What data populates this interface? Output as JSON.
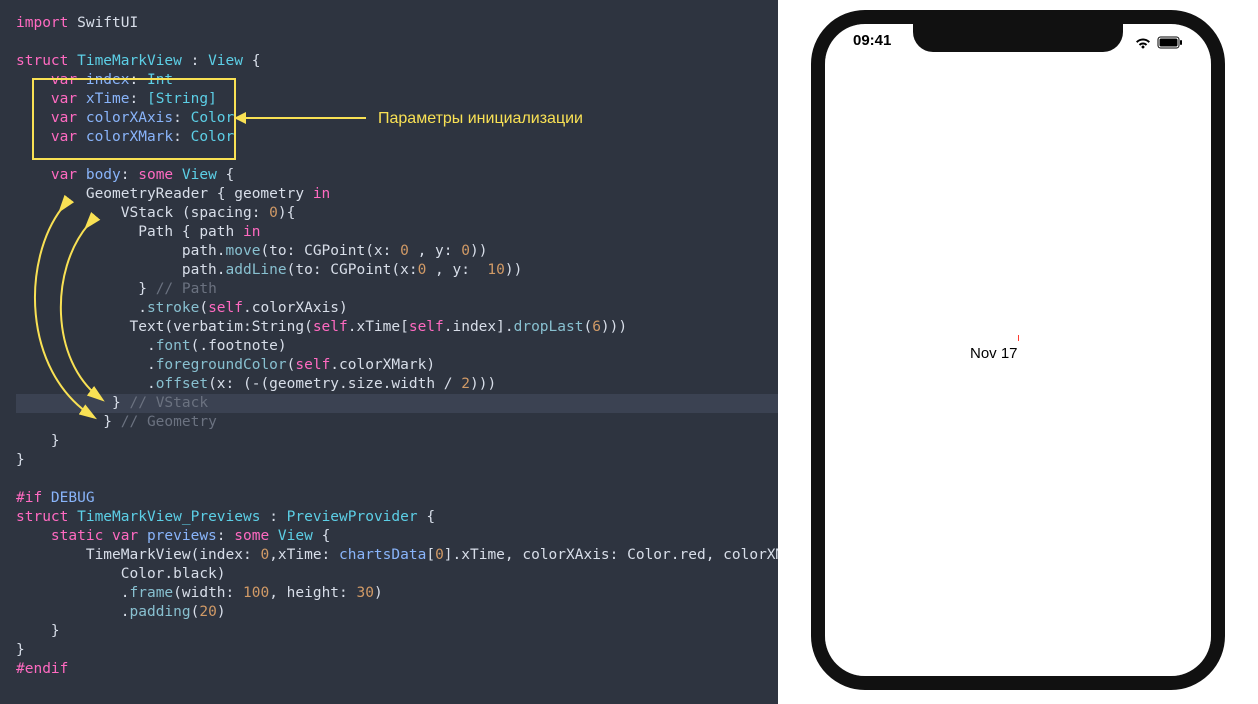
{
  "annotation": {
    "label": "Параметры инициализации"
  },
  "phone": {
    "time": "09:41",
    "content_label": "Nov 17"
  },
  "code": {
    "l1_import": "import",
    "l1_mod": " SwiftUI",
    "l3_struct": "struct",
    "l3_name": " TimeMarkView ",
    "l3_colon": ": ",
    "l3_view": "View",
    "l3_brace": " {",
    "l4_var": "    var",
    "l4_name": " index",
    "l4_colon": ": ",
    "l4_type": "Int",
    "l5_var": "    var",
    "l5_name": " xTime",
    "l5_colon": ": ",
    "l5_type": "[String]",
    "l6_var": "    var",
    "l6_name": " colorXAxis",
    "l6_colon": ": ",
    "l6_type": "Color",
    "l7_var": "    var",
    "l7_name": " colorXMark",
    "l7_colon": ": ",
    "l7_type": "Color",
    "l9_var": "    var",
    "l9_name": " body",
    "l9_colon": ": ",
    "l9_some": "some",
    "l9_view": " View",
    "l9_brace": " {",
    "l10": "        GeometryReader { geometry ",
    "l10_in": "in",
    "l11a": "            VStack (spacing: ",
    "l11b": "0",
    "l11c": "){",
    "l12a": "              Path { path ",
    "l12_in": "in",
    "l13a": "                   path.",
    "l13b": "move",
    "l13c": "(to: CGPoint(x: ",
    "l13d": "0",
    "l13e": " , y: ",
    "l13f": "0",
    "l13g": "))",
    "l14a": "                   path.",
    "l14b": "addLine",
    "l14c": "(to: CGPoint(x:",
    "l14d": "0",
    "l14e": " , y:  ",
    "l14f": "10",
    "l14g": "))",
    "l15a": "              } ",
    "l15b": "// Path",
    "l16a": "              .",
    "l16b": "stroke",
    "l16c": "(",
    "l16d": "self",
    "l16e": ".colorXAxis)",
    "l17a": "             Text(verbatim:String(",
    "l17b": "self",
    "l17c": ".xTime[",
    "l17d": "self",
    "l17e": ".index].",
    "l17f": "dropLast",
    "l17g": "(",
    "l17h": "6",
    "l17i": ")))",
    "l18a": "               .",
    "l18b": "font",
    "l18c": "(.footnote)",
    "l19a": "               .",
    "l19b": "foregroundColor",
    "l19c": "(",
    "l19d": "self",
    "l19e": ".colorXMark)",
    "l20a": "               .",
    "l20b": "offset",
    "l20c": "(x: (-(geometry.size.width / ",
    "l20d": "2",
    "l20e": ")))",
    "l21a": "           } ",
    "l21b": "// VStack",
    "l22a": "          } ",
    "l22b": "// Geometry",
    "l23": "    }",
    "l24": "}",
    "l26_if": "#if",
    "l26_dbg": " DEBUG",
    "l27_struct": "struct",
    "l27_name": " TimeMarkView_Previews ",
    "l27_colon": ": ",
    "l27_pp": "PreviewProvider",
    "l27_brace": " {",
    "l28a": "    static var",
    "l28b": " previews",
    "l28c": ": ",
    "l28d": "some",
    "l28e": " View",
    "l28f": " {",
    "l29a": "        TimeMarkView(index: ",
    "l29b": "0",
    "l29c": ",xTime: ",
    "l29d": "chartsData",
    "l29e": "[",
    "l29f": "0",
    "l29g": "].xTime, colorXAxis: Color.red, colorXMark",
    "l30a": "            Color.black)",
    "l31a": "            .",
    "l31b": "frame",
    "l31c": "(width: ",
    "l31d": "100",
    "l31e": ", height: ",
    "l31f": "30",
    "l31g": ")",
    "l32a": "            .",
    "l32b": "padding",
    "l32c": "(",
    "l32d": "20",
    "l32e": ")",
    "l33": "    }",
    "l34": "}",
    "l35": "#endif"
  }
}
